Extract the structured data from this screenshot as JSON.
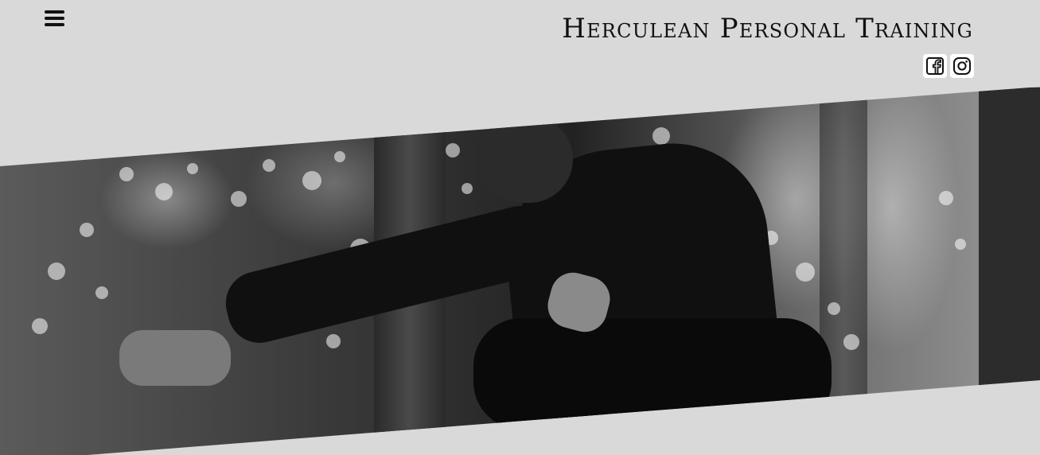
{
  "header": {
    "site_title": "Herculean Personal Training"
  },
  "menu": {
    "icon": "hamburger-menu-icon"
  },
  "social": {
    "facebook_icon": "facebook-icon",
    "instagram_icon": "instagram-icon"
  },
  "hero": {
    "image": "grayscale-photo-person-stretching-outdoors"
  },
  "colors": {
    "background": "#d9d9d9",
    "text": "#111111",
    "icon_background": "#ffffff"
  }
}
